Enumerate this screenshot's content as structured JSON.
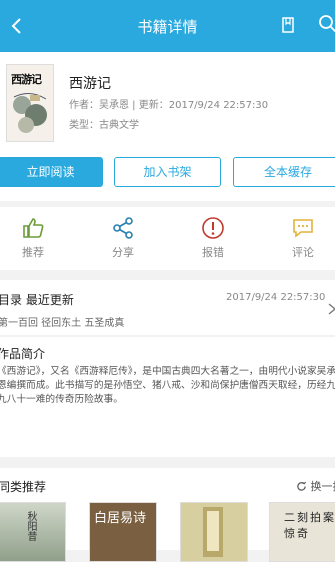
{
  "header": {
    "title": "书籍详情"
  },
  "book": {
    "cover_title": "西游记",
    "title": "西游记",
    "author_label": "作者：",
    "author": "吴承恩",
    "sep": " | ",
    "update_label": "更新：",
    "update_time": "2017/9/24 22:57:30",
    "type_label": "类型：",
    "type": "古典文学"
  },
  "buttons": {
    "read": "立即阅读",
    "shelf": "加入书架",
    "cache": "全本缓存"
  },
  "actions": [
    {
      "label": "推荐",
      "icon": "thumbs-up-icon"
    },
    {
      "label": "分享",
      "icon": "share-icon"
    },
    {
      "label": "报错",
      "icon": "alert-icon"
    },
    {
      "label": "评论",
      "icon": "comment-icon"
    }
  ],
  "toc": {
    "label": "目录  最近更新",
    "date": "2017/9/24 22:57:30",
    "chapter": "第一百回 径回东土 五圣成真"
  },
  "intro": {
    "heading": "作品简介",
    "text": "《西游记》，又名《西游释厄传》，是中国古典四大名著之一，由明代小说家吴承恩编撰而成。此书描写的是孙悟空、猪八戒、沙和尚保护唐僧西天取经，历经九九八十一难的传奇历险故事。"
  },
  "similar": {
    "heading": "同类推荐",
    "swap": "换一批",
    "books": [
      "秋阳昔",
      "白居易诗",
      "",
      "二刻拍案惊奇"
    ]
  },
  "colors": {
    "accent": "#2aa9df",
    "alert": "#c0392b",
    "like": "#6d9b3a",
    "comment": "#e3b23c"
  }
}
